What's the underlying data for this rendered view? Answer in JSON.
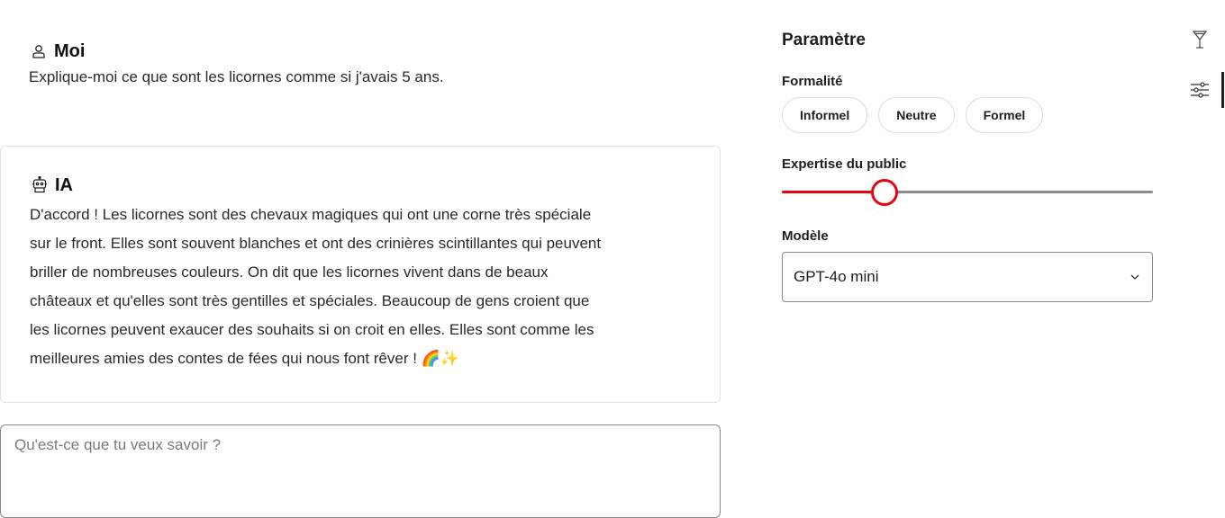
{
  "chat": {
    "user_message": {
      "author": "Moi",
      "icon": "user-icon",
      "text": "Explique-moi ce que sont les licornes comme si j'avais 5 ans."
    },
    "ai_message": {
      "author": "IA",
      "icon": "robot-icon",
      "lines": [
        "D'accord ! Les licornes sont des chevaux magiques qui ont une corne très spéciale",
        "sur le front. Elles sont souvent blanches et ont des crinières scintillantes qui peuvent",
        "briller de nombreuses couleurs. On dit que les licornes vivent dans de beaux",
        "châteaux et qu'elles sont très gentilles et spéciales. Beaucoup de gens croient que",
        "les licornes peuvent exaucer des souhaits si on croit en elles. Elles sont comme les",
        "meilleures amies des contes de fées qui nous font rêver ! 🌈✨"
      ]
    },
    "input": {
      "placeholder": "Qu'est-ce que tu veux savoir ?",
      "value": ""
    }
  },
  "settings": {
    "title": "Paramètre",
    "formality": {
      "label": "Formalité",
      "options": [
        "Informel",
        "Neutre",
        "Formel"
      ]
    },
    "audience": {
      "label": "Expertise du public",
      "value_fraction": 0.277,
      "accent": "#e4060f"
    },
    "model": {
      "label": "Modèle",
      "selected": "GPT-4o mini"
    }
  },
  "rail": {
    "items": [
      {
        "icon": "cocktail-icon",
        "active": false
      },
      {
        "icon": "settings-sliders-icon",
        "active": true
      }
    ]
  }
}
